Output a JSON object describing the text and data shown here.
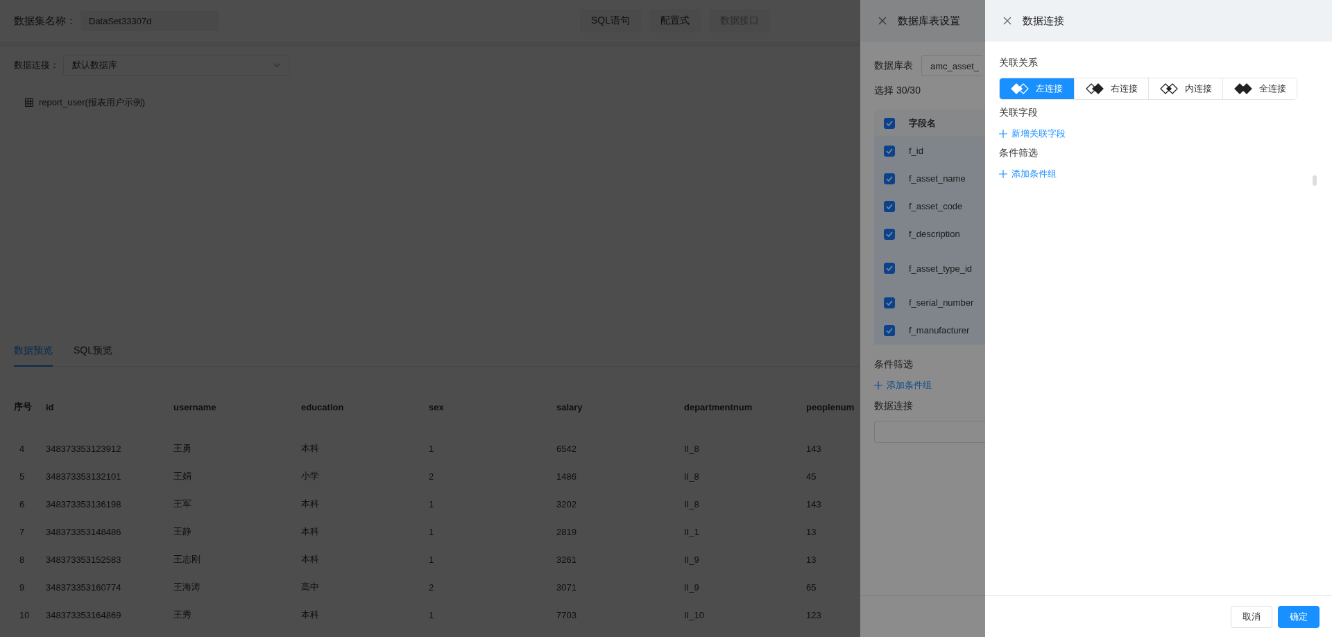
{
  "header": {
    "label": "数据集名称：",
    "dataset_name": "DataSet33307d",
    "modes": [
      {
        "label": "SQL语句",
        "disabled": false
      },
      {
        "label": "配置式",
        "disabled": false
      },
      {
        "label": "数据接口",
        "disabled": true
      }
    ]
  },
  "connection": {
    "label": "数据连接：",
    "value": "默认数据库"
  },
  "tables": [
    {
      "name": "report_user(报表用户示例)"
    }
  ],
  "preview_tabs": [
    {
      "label": "数据预览",
      "selected": true
    },
    {
      "label": "SQL预览",
      "selected": false
    }
  ],
  "table": {
    "columns": [
      "序号",
      "id",
      "username",
      "education",
      "sex",
      "salary",
      "departmentnum",
      "peoplenum"
    ],
    "rows": [
      [
        "4",
        "348373353123912",
        "王勇",
        "本科",
        "1",
        "6542",
        "II_8",
        "143"
      ],
      [
        "5",
        "348373353132101",
        "王娟",
        "小学",
        "2",
        "1486",
        "II_8",
        "45"
      ],
      [
        "6",
        "348373353136198",
        "王军",
        "本科",
        "1",
        "3202",
        "II_8",
        "143"
      ],
      [
        "7",
        "348373353148486",
        "王静",
        "本科",
        "1",
        "2819",
        "II_1",
        "13"
      ],
      [
        "8",
        "348373353152583",
        "王志刚",
        "本科",
        "1",
        "3261",
        "II_9",
        "13"
      ],
      [
        "9",
        "348373353160774",
        "王海涛",
        "高中",
        "2",
        "3071",
        "II_9",
        "65"
      ],
      [
        "10",
        "348373353164869",
        "王秀",
        "本科",
        "1",
        "7703",
        "II_10",
        "123"
      ]
    ]
  },
  "table_drawer": {
    "title": "数据库表设置",
    "table_label": "数据库表",
    "table_value": "amc_asset_",
    "selection": "选择 30/30",
    "field_header": {
      "label": "字段名",
      "checked": true
    },
    "fields": [
      {
        "name": "f_id",
        "checked": true
      },
      {
        "name": "f_asset_name",
        "checked": true
      },
      {
        "name": "f_asset_code",
        "checked": true
      },
      {
        "name": "f_description",
        "checked": true
      },
      {
        "name": "f_asset_type_id",
        "checked": true
      },
      {
        "name": "f_serial_number",
        "checked": true
      },
      {
        "name": "f_manufacturer",
        "checked": true
      }
    ],
    "filter_title": "条件筛选",
    "add_group": "添加条件组",
    "connection_title": "数据连接"
  },
  "join_drawer": {
    "title": "数据连接",
    "relation_title": "关联关系",
    "joins": [
      {
        "kind": "left",
        "label": "左连接",
        "selected": true
      },
      {
        "kind": "right",
        "label": "右连接",
        "selected": false
      },
      {
        "kind": "inner",
        "label": "内连接",
        "selected": false
      },
      {
        "kind": "full",
        "label": "全连接",
        "selected": false
      }
    ],
    "field_title": "关联字段",
    "add_field": "新增关联字段",
    "filter_title": "条件筛选",
    "add_group": "添加条件组",
    "buttons": [
      {
        "label": "取消",
        "kind": "default"
      },
      {
        "label": "确定",
        "kind": "primary"
      }
    ]
  }
}
